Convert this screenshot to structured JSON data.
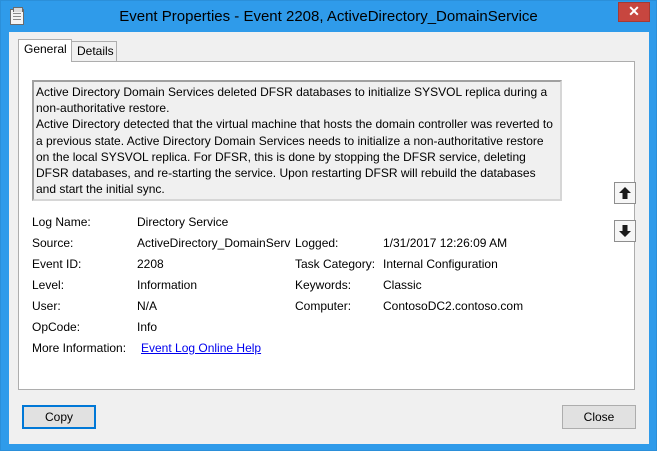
{
  "window": {
    "title": "Event Properties - Event 2208, ActiveDirectory_DomainService",
    "close_glyph": "✕"
  },
  "tabs": [
    {
      "label": "General"
    },
    {
      "label": "Details"
    }
  ],
  "description": {
    "paragraph1": "Active Directory Domain Services deleted DFSR databases to initialize SYSVOL replica during a non-authoritative restore.",
    "paragraph2": "Active Directory detected that the virtual machine that hosts the domain controller was reverted to a previous state. Active Directory Domain Services needs to initialize a non-authoritative restore on the local SYSVOL replica. For DFSR, this is done by stopping the DFSR service, deleting DFSR databases, and re-starting the service. Upon restarting DFSR will rebuild the databases and start the initial sync."
  },
  "fields": {
    "log_name_label": "Log Name:",
    "log_name_value": "Directory Service",
    "source_label": "Source:",
    "source_value": "ActiveDirectory_DomainServ",
    "logged_label": "Logged:",
    "logged_value": "1/31/2017 12:26:09 AM",
    "event_id_label": "Event ID:",
    "event_id_value": "2208",
    "task_category_label": "Task Category:",
    "task_category_value": "Internal Configuration",
    "level_label": "Level:",
    "level_value": "Information",
    "keywords_label": "Keywords:",
    "keywords_value": "Classic",
    "user_label": "User:",
    "user_value": "N/A",
    "computer_label": "Computer:",
    "computer_value": "ContosoDC2.contoso.com",
    "opcode_label": "OpCode:",
    "opcode_value": "Info",
    "more_info_label": "More Information:",
    "more_info_link": "Event Log Online Help"
  },
  "buttons": {
    "copy": "Copy",
    "close": "Close"
  },
  "icons": {
    "app": "event-properties-icon",
    "up": "arrow-up-icon",
    "down": "arrow-down-icon"
  }
}
